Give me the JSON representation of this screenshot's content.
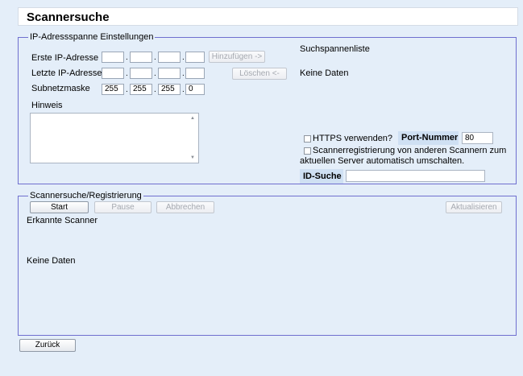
{
  "page": {
    "title": "Scannersuche"
  },
  "ip_range": {
    "legend": "IP-Adressspanne Einstellungen",
    "first_ip_label": "Erste IP-Adresse",
    "last_ip_label": "Letzte IP-Adresse",
    "subnet_label": "Subnetzmaske",
    "first_ip": [
      "",
      "",
      "",
      ""
    ],
    "last_ip": [
      "",
      "",
      "",
      ""
    ],
    "subnet": [
      "255",
      "255",
      "255",
      "0"
    ],
    "add_button": "Hinzufügen ->",
    "delete_button": "Löschen <-",
    "hint_label": "Hinweis",
    "hint_value": "",
    "range_list_title": "Suchspannenliste",
    "range_list_empty": "Keine Daten",
    "https_label": "HTTPS verwenden?",
    "https_checked": false,
    "port_label": "Port-Nummer",
    "port_value": "80",
    "auto_switch_label_1": "Scannerregistrierung von anderen Scannern zum",
    "auto_switch_label_2": "aktuellen Server automatisch umschalten.",
    "auto_switch_checked": false,
    "id_search_label": "ID-Suche",
    "id_search_value": ""
  },
  "search": {
    "legend": "Scannersuche/Registrierung",
    "start_button": "Start",
    "pause_button": "Pause",
    "cancel_button": "Abbrechen",
    "refresh_button": "Aktualisieren",
    "detected_label": "Erkannte Scanner",
    "empty_text": "Keine Daten"
  },
  "footer": {
    "back_button": "Zurück"
  }
}
